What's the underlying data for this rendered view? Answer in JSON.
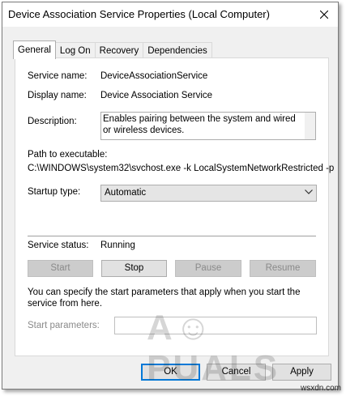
{
  "window": {
    "title": "Device Association Service Properties (Local Computer)"
  },
  "tabs": [
    {
      "label": "General"
    },
    {
      "label": "Log On"
    },
    {
      "label": "Recovery"
    },
    {
      "label": "Dependencies"
    }
  ],
  "general": {
    "service_name_label": "Service name:",
    "service_name_value": "DeviceAssociationService",
    "display_name_label": "Display name:",
    "display_name_value": "Device Association Service",
    "description_label": "Description:",
    "description_value": "Enables pairing between the system and wired or wireless devices.",
    "path_label": "Path to executable:",
    "path_value": "C:\\WINDOWS\\system32\\svchost.exe -k LocalSystemNetworkRestricted -p",
    "startup_type_label": "Startup type:",
    "startup_type_value": "Automatic",
    "service_status_label": "Service status:",
    "service_status_value": "Running",
    "buttons": {
      "start": "Start",
      "stop": "Stop",
      "pause": "Pause",
      "resume": "Resume"
    },
    "hint_text": "You can specify the start parameters that apply when you start the service from here.",
    "start_params_label": "Start parameters:",
    "start_params_value": ""
  },
  "footer": {
    "ok": "OK",
    "cancel": "Cancel",
    "apply": "Apply"
  },
  "watermark": {
    "logo_text": "APPUALS",
    "site": "wsxdn.com"
  },
  "icons": {
    "close": "close-icon",
    "dropdown": "chevron-down-icon"
  },
  "colors": {
    "dialog_bg": "#f0f0f0",
    "panel_bg": "#ffffff",
    "button_bg": "#e1e1e1",
    "disabled_button_bg": "#cccccc",
    "focus_border": "#0078d7"
  }
}
